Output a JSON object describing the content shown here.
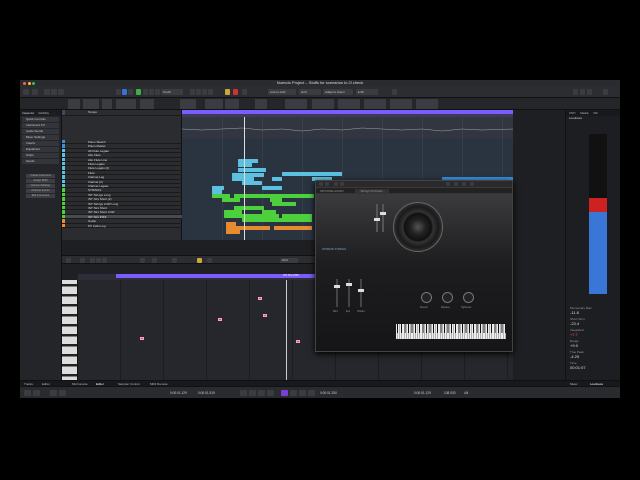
{
  "window": {
    "title": "Nuendo Project – Stuffs for scenarios to 2l check"
  },
  "colors": {
    "accent": "#7b5cff",
    "green": "#3cb043",
    "meter_red": "#c22222",
    "meter_blue": "#3a76d6",
    "note": "#d94b8a"
  },
  "toolbar": {
    "touch_label": "Touch",
    "grid_label": "Grid",
    "link_zoom": "Link to Grid",
    "adapt_zoom": "Adapt to Zoom",
    "quantize": "1/16"
  },
  "inspector": {
    "tabs": [
      "Inspector",
      "Visibility"
    ],
    "sections": [
      "Quick Controls",
      "Instrument FX",
      "Audio Sends",
      "Mixer Settings",
      "Inserts",
      "Equalizers",
      "Strips",
      "Sends"
    ],
    "buttons": [
      "Create Instrument",
      "Assign MIDI",
      "Channel Settings",
      "Channel Inserts",
      "Edit Instrument"
    ]
  },
  "tracks": [
    {
      "name": "Tempo",
      "color": "#3a4b6a"
    },
    {
      "name": "Piano Sketch",
      "color": "#3b8fd9"
    },
    {
      "name": "Piano Master",
      "color": "#3b8fd9"
    },
    {
      "name": "Alt Flute Legato",
      "color": "#5cc0e0"
    },
    {
      "name": "Alto Flute",
      "color": "#5cc0e0"
    },
    {
      "name": "Alto Flute Line",
      "color": "#5cc0e0"
    },
    {
      "name": "Flute Legato",
      "color": "#5cc0e0"
    },
    {
      "name": "Flute Legato (2)",
      "color": "#5cc0e0"
    },
    {
      "name": "Flute",
      "color": "#5cc0e0"
    },
    {
      "name": "Clarinet Leg",
      "color": "#5cc0e0"
    },
    {
      "name": "Clarinet (2)",
      "color": "#5cc0e0"
    },
    {
      "name": "Clarinet Legato",
      "color": "#5cc0e0"
    },
    {
      "name": "STRINGS",
      "color": "#4cd13c"
    },
    {
      "name": "INT Strings Long",
      "color": "#4cd13c"
    },
    {
      "name": "INT Strs Short (2)",
      "color": "#4cd13c"
    },
    {
      "name": "INT Strings LOW Long",
      "color": "#4cd13c"
    },
    {
      "name": "INT Strs Short",
      "color": "#4cd13c"
    },
    {
      "name": "INT Strs Short LOW",
      "color": "#4cd13c"
    },
    {
      "name": "INT Strs PIZZ",
      "color": "#4cd13c"
    },
    {
      "name": "Guitar",
      "color": "#e88a2e"
    },
    {
      "name": "PX Cello Leg",
      "color": "#e88a2e"
    }
  ],
  "plugin": {
    "vendor": "SPITFIRE AUDIO",
    "patch": "Strings Pizzicato",
    "product": "INTIMATE STRINGS",
    "knob_labels": [
      "Reverb",
      "Release",
      "Tightness"
    ],
    "fader_labels": [
      "Mics",
      "Exp",
      "Vibrato"
    ]
  },
  "editor": {
    "tabs": [
      "Tracks",
      "Editor"
    ],
    "bottom_tabs": [
      "MixConsole",
      "Editor",
      "Sampler Control",
      "MIDI Remote"
    ],
    "part_label": "INT Strs PIZZ"
  },
  "loudness": {
    "header": "Loudness",
    "tabs": [
      "VSTi",
      "Media",
      "CR"
    ],
    "rows": [
      {
        "label": "Momentary Max.",
        "value": "-11.8",
        "red": false
      },
      {
        "label": "Short-Term",
        "value": "-23.4",
        "red": false
      },
      {
        "label": "Integrated",
        "value": "+7.7",
        "red": true
      },
      {
        "label": "Range",
        "value": "+9.9",
        "red": false
      },
      {
        "label": "True Peak",
        "value": "-4.25",
        "red": false
      },
      {
        "label": "Time",
        "value": "00:01:07",
        "red": false
      }
    ],
    "meter_level": 0.6
  },
  "status": {
    "left_tabs": [
      "Tracks",
      "Editor"
    ],
    "right_tabs": [
      "Meter",
      "Loudness"
    ]
  },
  "transport": {
    "left_locator": "0:00:01.129",
    "right_locator": "0:00:01.519",
    "position": "0:00:01.129",
    "time_display": "0:00:01.250",
    "tempo": "108.000",
    "signature": "4/4"
  }
}
